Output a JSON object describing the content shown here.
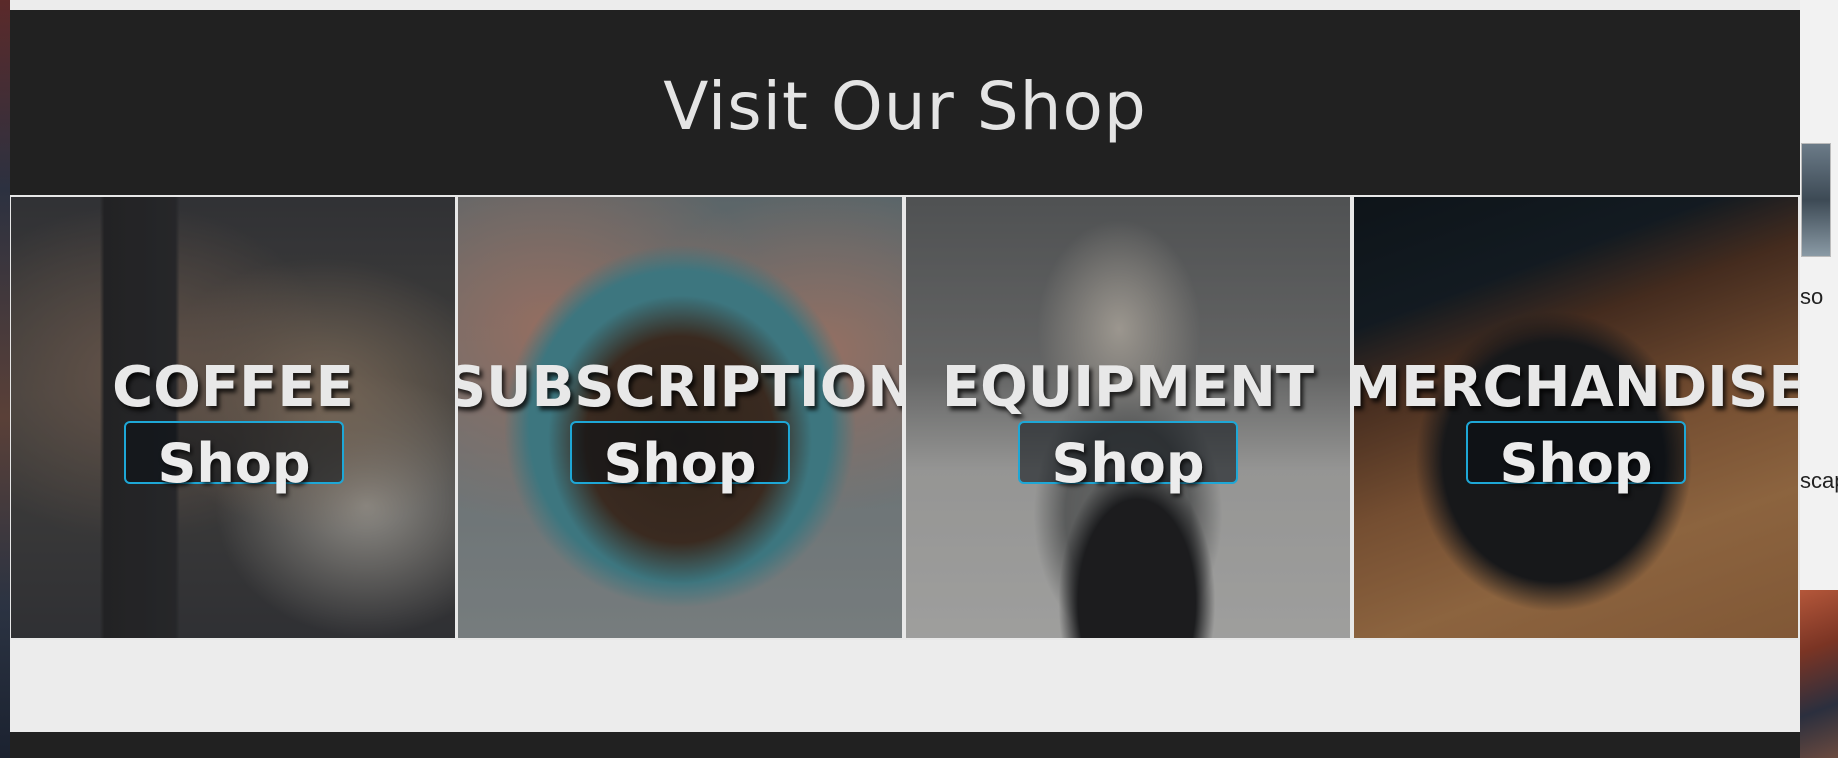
{
  "section": {
    "heading": "Visit Our Shop"
  },
  "tiles": [
    {
      "title": "COFFEE",
      "button_label": "Shop",
      "image": "coffee-bags-photo"
    },
    {
      "title": "SUBSCRIPTION",
      "button_label": "Shop",
      "image": "coffee-beans-bag-photo"
    },
    {
      "title": "EQUIPMENT",
      "button_label": "Shop",
      "image": "pour-over-brewer-photo"
    },
    {
      "title": "MERCHANDISE",
      "button_label": "Shop",
      "image": "never-settle-mug-photo"
    }
  ],
  "desktop": {
    "label_1": "so",
    "label_2": "scap"
  },
  "colors": {
    "section_background": "#212121",
    "heading_text": "#e4e4e4",
    "button_border": "#1ea7d6",
    "page_background": "#ececec"
  }
}
